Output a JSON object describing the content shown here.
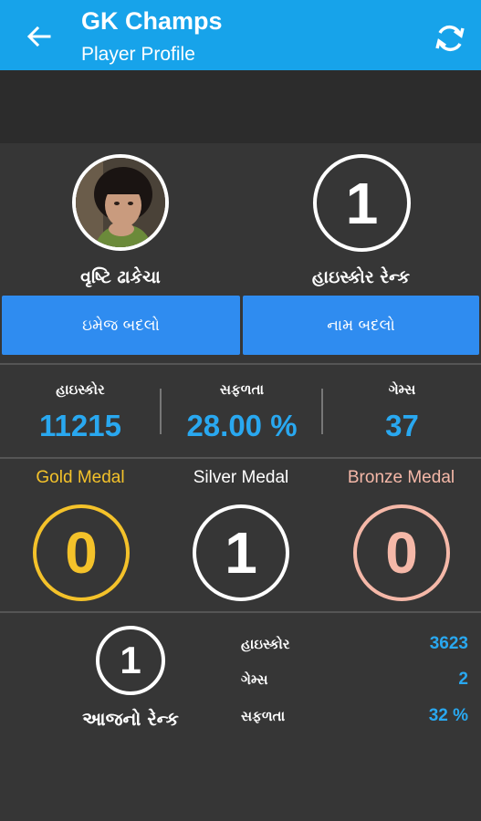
{
  "appbar": {
    "title": "GK Champs",
    "subtitle": "Player Profile",
    "back_icon": "arrow-left-icon",
    "refresh_icon": "refresh-icon"
  },
  "profile": {
    "player_name": "વૃષ્ટિ ઢાકેચા",
    "highscore_rank_value": "1",
    "highscore_rank_label": "હાઇસ્કોર રેન્ક",
    "change_image_label": "ઇમેજ બદલો",
    "change_name_label": "નામ બદલો"
  },
  "stats": [
    {
      "label": "હાઇસ્કોર",
      "value": "11215"
    },
    {
      "label": "સફળતા",
      "value": "28.00 %"
    },
    {
      "label": "ગેમ્સ",
      "value": "37"
    }
  ],
  "medals": [
    {
      "label": "Gold Medal",
      "value": "0",
      "color": "#f4c22a"
    },
    {
      "label": "Silver Medal",
      "value": "1",
      "color": "#ffffff"
    },
    {
      "label": "Bronze Medal",
      "value": "0",
      "color": "#f5b8a8"
    }
  ],
  "today": {
    "rank_value": "1",
    "rank_label": "આજનો રેન્ક",
    "rows": [
      {
        "label": "હાઇસ્કોર",
        "value": "3623"
      },
      {
        "label": "ગેમ્સ",
        "value": "2"
      },
      {
        "label": "સફળતા",
        "value": "32 %"
      }
    ]
  },
  "colors": {
    "appbar": "#17a3ea",
    "button": "#2f8cf0",
    "accent_value": "#29a8f0",
    "background": "#363636"
  }
}
